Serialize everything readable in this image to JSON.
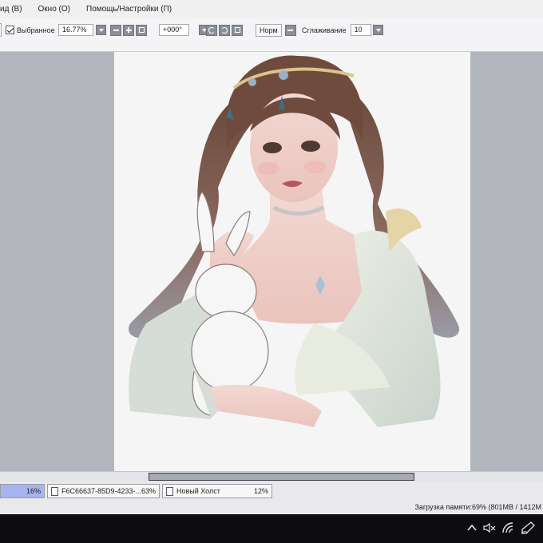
{
  "menu": {
    "items": [
      "ид (В)",
      "Окно (О)",
      "Помощь/Настройки (П)"
    ]
  },
  "toolbar": {
    "selected_label": "Выбранное",
    "zoom_value": "16.77%",
    "rotation_value": "+000°",
    "norm_label": "Норм",
    "smoothing_label": "Сглаживание",
    "smoothing_value": "10"
  },
  "canvas": {
    "image": "artwork-woman-with-crown-holding-white-rabbit"
  },
  "navigator": {
    "tabs": [
      {
        "name": "",
        "percent": "16%"
      },
      {
        "name": "F6C66637-85D9-4233-...",
        "percent": "63%"
      },
      {
        "name": "Новый Холст",
        "percent": "12%"
      }
    ]
  },
  "status": {
    "memory": "Загрузка памяти:69% (801MB / 1412M"
  },
  "taskbar": {
    "icons": [
      "chevron-up-icon",
      "speaker-muted-icon",
      "wifi-icon",
      "pen-icon"
    ]
  },
  "colors": {
    "workspace": "#b3b6bd",
    "accent_tab": "#a8b4f2"
  }
}
